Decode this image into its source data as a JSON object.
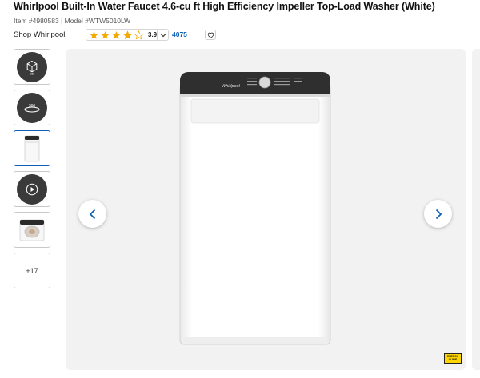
{
  "product": {
    "title": "Whirlpool Built-In Water Faucet 4.6-cu ft High Efficiency Impeller Top-Load Washer (White)",
    "item_meta": "Item #4980583 | Model #WTW5010LW",
    "brand_link": "Shop Whirlpool"
  },
  "rating": {
    "value": "3.9",
    "stars_filled": 3.9,
    "stars_total": 5,
    "review_count": "4075",
    "star_color": "#f2a900"
  },
  "gallery": {
    "thumbnails": [
      {
        "kind": "ar-view",
        "icon": "ar-cube-icon"
      },
      {
        "kind": "360-view",
        "icon": "rotate-360-icon"
      },
      {
        "kind": "photo",
        "icon": "washer-front-thumbnail",
        "active": true
      },
      {
        "kind": "video",
        "icon": "play-icon"
      },
      {
        "kind": "photo",
        "icon": "washer-open-thumbnail"
      }
    ],
    "more_label": "+17",
    "energy_guide_label": "ENERGY GUIDE",
    "accent_color": "#0b5fb8"
  }
}
